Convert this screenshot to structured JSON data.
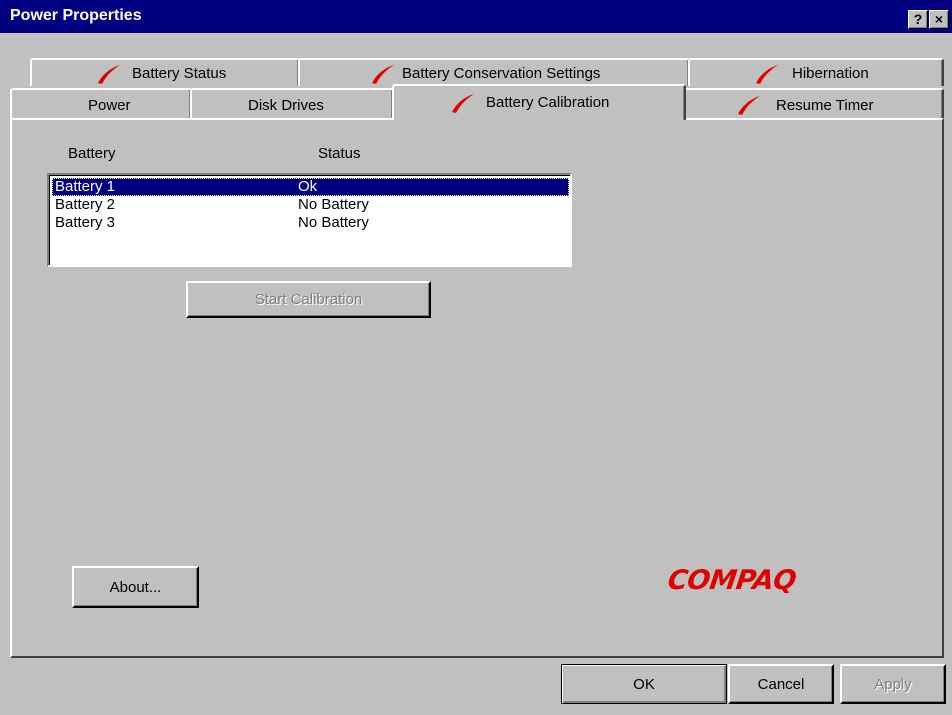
{
  "window": {
    "title": "Power Properties",
    "help_glyph": "?",
    "close_glyph": "×"
  },
  "tabs": {
    "row_back": [
      {
        "label": "Battery Status",
        "icon": "red-check-icon"
      },
      {
        "label": "Battery Conservation Settings",
        "icon": "red-check-icon"
      },
      {
        "label": "Hibernation",
        "icon": "red-check-icon"
      }
    ],
    "row_front": [
      {
        "label": "Power"
      },
      {
        "label": "Disk Drives"
      },
      {
        "label": "Battery Calibration",
        "icon": "red-check-icon",
        "active": true
      },
      {
        "label": "Resume Timer",
        "icon": "red-check-icon"
      }
    ]
  },
  "battery_list": {
    "columns": [
      "Battery",
      "Status"
    ],
    "rows": [
      {
        "battery": "Battery 1",
        "status": "Ok",
        "selected": true
      },
      {
        "battery": "Battery 2",
        "status": "No Battery"
      },
      {
        "battery": "Battery 3",
        "status": "No Battery"
      }
    ]
  },
  "buttons": {
    "start_calibration": "Start Calibration",
    "about": "About...",
    "ok": "OK",
    "cancel": "Cancel",
    "apply": "Apply"
  },
  "brand": {
    "logo_text": "COMPAQ",
    "logo_color": "#e00000"
  },
  "colors": {
    "title_bar": "#000080",
    "face": "#c0c0c0",
    "selection": "#000080",
    "check_mark": "#e00000"
  }
}
